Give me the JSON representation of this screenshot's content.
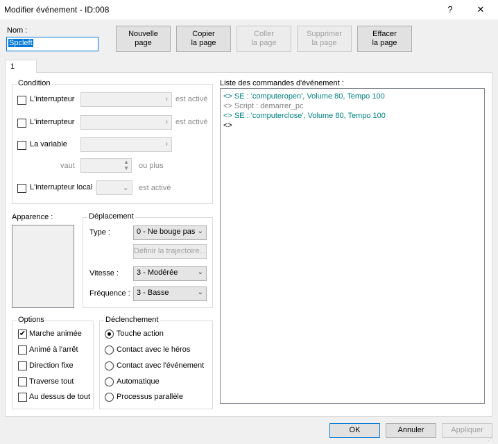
{
  "window": {
    "title": "Modifier événement - ID:008",
    "help_glyph": "?",
    "close_glyph": "✕"
  },
  "name_label": "Nom :",
  "name_value": "Spcleft",
  "page_buttons": {
    "new_page": "Nouvelle\npage",
    "copy_page": "Copier\nla page",
    "paste_page": "Coller\nla page",
    "delete_page": "Supprimer\nla page",
    "clear_page": "Effacer\nla page"
  },
  "tabs": [
    "1"
  ],
  "condition": {
    "title": "Condition",
    "switch1_label": "L'interrupteur",
    "switch1_suffix": "est activé",
    "switch2_label": "L'interrupteur",
    "switch2_suffix": "est activé",
    "variable_label": "La variable",
    "value_label": "vaut",
    "value_suffix": "ou plus",
    "self_switch_label": "L'interrupteur local",
    "self_switch_suffix": "est activé"
  },
  "appearance": {
    "title": "Apparence :"
  },
  "movement": {
    "title": "Déplacement",
    "type_label": "Type :",
    "type_value": "0 - Ne bouge pas",
    "route_button": "Définir la trajectoire...",
    "speed_label": "Vitesse :",
    "speed_value": "3 - Modérée",
    "freq_label": "Fréquence :",
    "freq_value": "3 - Basse"
  },
  "options": {
    "title": "Options",
    "items": [
      {
        "label": "Marche animée",
        "checked": true
      },
      {
        "label": "Animé à l'arrêt",
        "checked": false
      },
      {
        "label": "Direction fixe",
        "checked": false
      },
      {
        "label": "Traverse tout",
        "checked": false
      },
      {
        "label": "Au dessus de tout",
        "checked": false
      }
    ]
  },
  "trigger": {
    "title": "Déclenchement",
    "items": [
      {
        "label": "Touche action",
        "selected": true
      },
      {
        "label": "Contact avec le héros",
        "selected": false
      },
      {
        "label": "Contact avec l'événement",
        "selected": false
      },
      {
        "label": "Automatique",
        "selected": false
      },
      {
        "label": "Processus parallèle",
        "selected": false
      }
    ]
  },
  "commands": {
    "title": "Liste des commandes d'événement :",
    "lines": [
      {
        "text": "<> SE : 'computeropen', Volume 80, Tempo 100",
        "color": "#008080"
      },
      {
        "text": "<> Script : demarrer_pc",
        "color": "#808080"
      },
      {
        "text": "<> SE : 'computerclose', Volume 80, Tempo 100",
        "color": "#008080"
      },
      {
        "text": "<>",
        "color": "#000000"
      }
    ]
  },
  "footer": {
    "ok": "OK",
    "cancel": "Annuler",
    "apply": "Appliquer"
  }
}
